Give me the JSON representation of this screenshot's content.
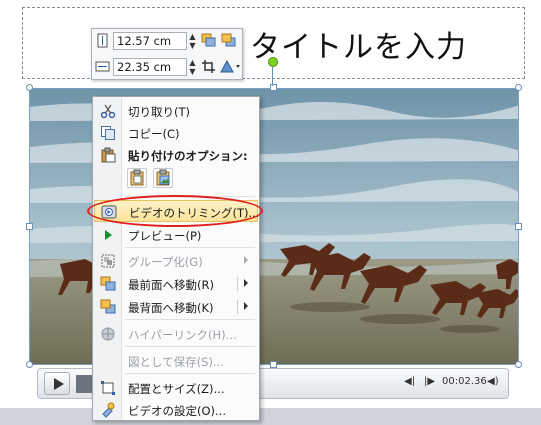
{
  "title_placeholder": {
    "text": "タイトルを入力"
  },
  "mini_toolbar": {
    "height_value": "12.57 cm",
    "width_value": "22.35 cm",
    "height_icon": "height-icon",
    "width_icon": "width-icon"
  },
  "player": {
    "time": "00:02.36"
  },
  "context_menu": {
    "items": [
      {
        "label": "切り取り(T)",
        "icon": "scissors-icon",
        "enabled": true
      },
      {
        "label": "コピー(C)",
        "icon": "copy-icon",
        "enabled": true
      },
      {
        "label": "貼り付けのオプション:",
        "icon": "paste-icon",
        "header": true
      },
      {
        "label": "ビデオのトリミング(T)...",
        "icon": "trim-video-icon",
        "enabled": true,
        "highlighted": true
      },
      {
        "label": "プレビュー(P)",
        "icon": "play-icon",
        "enabled": true
      },
      {
        "label": "グループ化(G)",
        "icon": "group-icon",
        "enabled": false,
        "submenu": true
      },
      {
        "label": "最前面へ移動(R)",
        "icon": "bring-to-front-icon",
        "enabled": true,
        "submenu": true
      },
      {
        "label": "最背面へ移動(K)",
        "icon": "send-to-back-icon",
        "enabled": true,
        "submenu": true
      },
      {
        "label": "ハイパーリンク(H)...",
        "icon": "hyperlink-icon",
        "enabled": false
      },
      {
        "label": "図として保存(S)...",
        "icon": "",
        "enabled": false
      },
      {
        "label": "配置とサイズ(Z)...",
        "icon": "size-position-icon",
        "enabled": true
      },
      {
        "label": "ビデオの設定(O)...",
        "icon": "video-settings-icon",
        "enabled": true
      }
    ]
  },
  "colors": {
    "highlight": "#fbe39a",
    "annotation_oval": "#e0201b",
    "sea": "#7fa3b5",
    "sand": "#8c8a72"
  }
}
